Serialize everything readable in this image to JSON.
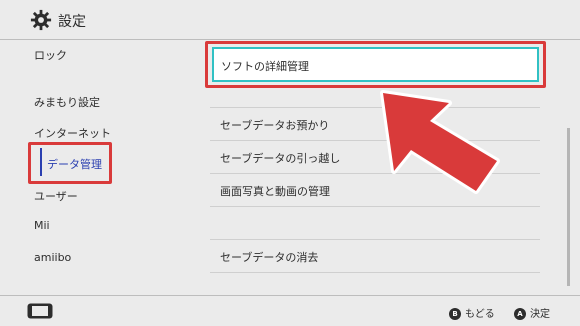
{
  "header": {
    "title": "設定",
    "icon": "gear-icon"
  },
  "sidebar": {
    "items": [
      {
        "label": "ロック"
      },
      {
        "label": "みまもり設定"
      },
      {
        "label": "インターネット"
      },
      {
        "label": "データ管理",
        "selected": true
      },
      {
        "label": "ユーザー"
      },
      {
        "label": "Mii"
      },
      {
        "label": "amiibo"
      }
    ]
  },
  "main": {
    "focused_item": "ソフトの詳細管理",
    "items": [
      {
        "label": "セーブデータお預かり"
      },
      {
        "label": "セーブデータの引っ越し"
      },
      {
        "label": "画面写真と動画の管理"
      },
      {
        "label": ""
      },
      {
        "label": "セーブデータの消去"
      }
    ]
  },
  "footer": {
    "back": {
      "button": "B",
      "label": "もどる"
    },
    "confirm": {
      "button": "A",
      "label": "決定"
    }
  },
  "colors": {
    "accent": "#2a3fb0",
    "focus": "#31c1c4",
    "highlight_annotation": "#d93a3a"
  }
}
